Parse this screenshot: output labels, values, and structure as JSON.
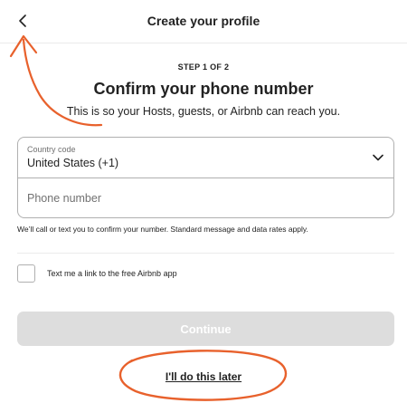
{
  "header": {
    "title": "Create your profile",
    "back_icon": "chevron-left-icon"
  },
  "step": "STEP 1 OF 2",
  "heading": "Confirm your phone number",
  "subheading": "This is so your Hosts, guests, or Airbnb can reach you.",
  "country": {
    "label": "Country code",
    "value": "United States (+1)",
    "icon": "chevron-down-icon"
  },
  "phone": {
    "placeholder": "Phone number",
    "value": ""
  },
  "disclaimer": "We’ll call or text you to confirm your number. Standard message and data rates apply.",
  "checkbox": {
    "label": "Text me a link to the free Airbnb app",
    "checked": false
  },
  "continue_label": "Continue",
  "later_label": "I'll do this later",
  "colors": {
    "annotation": "#E8612C",
    "disabled_button": "#DDDDDD",
    "text": "#222222",
    "muted": "#717171"
  }
}
